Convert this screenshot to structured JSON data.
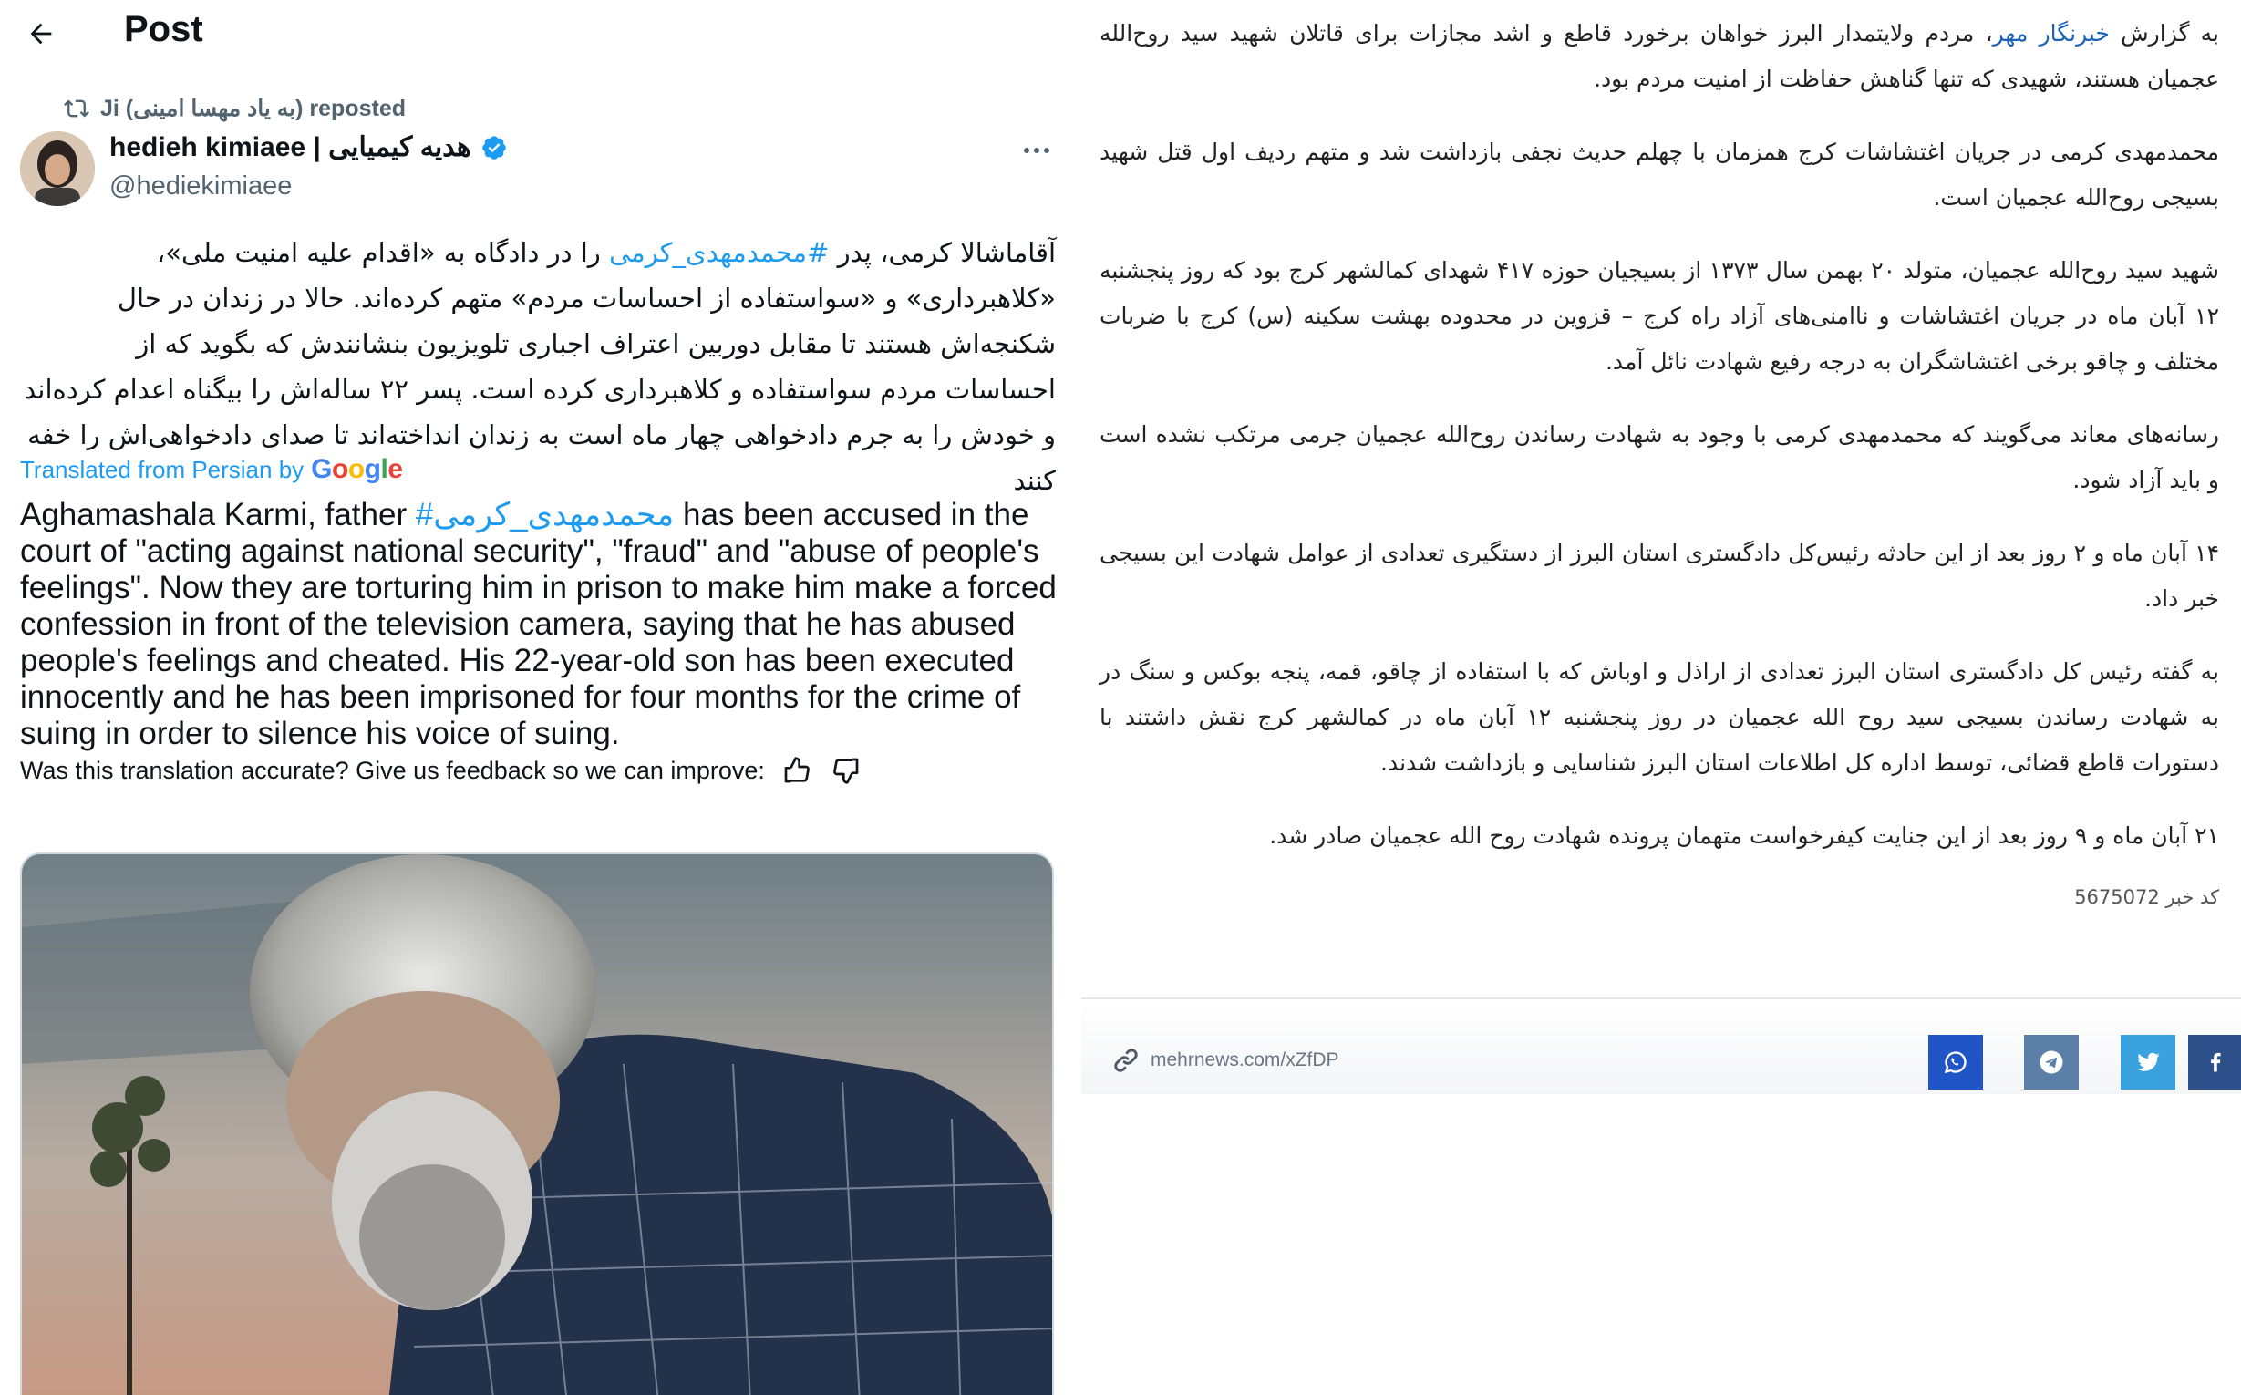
{
  "post": {
    "title": "Post",
    "repost_label": "Ji (به یاد مهسا امینی) reposted",
    "author_name": "hedieh kimiaee | هدیه کیمیایی",
    "author_handle": "@hediekimiaee",
    "verified": true,
    "text_fa_1": "آقاماشالا کرمی، پدر ",
    "hashtag": "#محمدمهدی_کرمی",
    "text_fa_2": " را در دادگاه به «اقدام علیه امنیت ملی»، «کلاهبرداری» و «سواستفاده از احساسات مردم» متهم کرده‌اند. حالا در زندان در حال شکنجه‌اش هستند تا مقابل دوربین اعتراف اجباری تلویزیون بنشانندش که بگوید که از احساسات مردم سواستفاده و کلاهبرداری کرده است. پسر ۲۲ ساله‌اش را بیگناه اعدام کرده‌اند و خودش را به جرم دادخواهی چهار ماه است به زندان انداخته‌اند تا صدای دادخواهی‌اش را خفه کنند",
    "translated_label": "Translated from Persian by",
    "google_label": "Google",
    "text_en_1": "Aghamashala Karmi, father ",
    "text_en_hashtag": "#محمدمهدی_کرمی",
    "text_en_2": " has been accused in the court of \"acting against national security\", \"fraud\" and \"abuse of people's feelings\". Now they are torturing him in prison to make him make a forced confession in front of the television camera, saying that he has abused people's feelings and cheated. His 22-year-old son has been executed innocently and he has been imprisoned for four months for the crime of suing in order to silence his voice of suing.",
    "feedback_text": "Was this translation accurate? Give us feedback so we can improve:",
    "icons": {
      "back": "arrow-left-icon",
      "repost": "repost-icon",
      "verified": "verified-badge-icon",
      "more": "more-icon",
      "thumbs_up": "thumbs-up-icon",
      "thumbs_down": "thumbs-down-icon"
    }
  },
  "article": {
    "p1_prefix": "به گزارش ",
    "p1_link": "خبرنگار مهر",
    "p1_rest": "، مردم ولایتمدار البرز خواهان برخورد قاطع و اشد مجازات برای قاتلان شهید سید روح‌الله عجمیان هستند، شهیدی که تنها گناهش حفاظت از امنیت مردم بود.",
    "p2": "محمدمهدی کرمی در جریان اغتشاشات کرج همزمان با چهلم حدیث نجفی بازداشت شد و متهم ردیف اول قتل شهید بسیجی روح‌الله عجمیان است.",
    "p3": "شهید سید روح‌الله عجمیان، متولد ۲۰ بهمن سال ۱۳۷۳ از بسیجیان حوزه ۴۱۷ شهدای کمالشهر کرج بود که روز پنجشنبه ۱۲ آبان ماه در جریان اغتشاشات و ناامنی‌های آزاد راه کرج – قزوین در محدوده بهشت سکینه (س) کرج با ضربات مختلف و چاقو برخی اغتشاشگران به درجه رفیع شهادت نائل آمد.",
    "p4": "رسانه‌های معاند می‌گویند که محمدمهدی کرمی با وجود به شهادت رساندن روح‌الله عجمیان جرمی مرتکب نشده است و باید آزاد شود.",
    "p5": "۱۴ آبان ماه و ۲ روز بعد از این حادثه رئیس‌کل دادگستری استان البرز از دستگیری تعدادی از عوامل شهادت این بسیجی خبر داد.",
    "p6": "به گفته رئیس کل دادگستری استان البرز تعدادی از اراذل و اوباش که با استفاده از چاقو، قمه، پنجه بوکس و سنگ در به شهادت رساندن بسیجی سید روح الله عجمیان در روز پنجشنبه ۱۲ آبان ماه در کمالشهر کرج نقش داشتند با دستورات قاطع قضائی، توسط اداره کل اطلاعات استان البرز شناسایی و بازداشت شدند.",
    "p7": "۲۱ آبان ماه و ۹ روز بعد از این جنایت کیفرخواست متهمان پرونده شهادت روح الله عجمیان صادر شد.",
    "news_code": "کد خبر 5675072",
    "short_link": "mehrnews.com/xZfDP",
    "share_buttons": [
      {
        "name": "whatsapp",
        "color": "#1f55c6",
        "icon": "whatsapp-icon"
      },
      {
        "name": "telegram",
        "color": "#5b7fa6",
        "icon": "telegram-icon"
      },
      {
        "name": "twitter",
        "color": "#3aa3df",
        "icon": "twitter-icon"
      },
      {
        "name": "facebook",
        "color": "#2d4f8a",
        "icon": "facebook-icon"
      }
    ]
  },
  "colors": {
    "accent_blue": "#1d9bf0",
    "secondary_text": "#536471",
    "article_link": "#1e63b8"
  }
}
